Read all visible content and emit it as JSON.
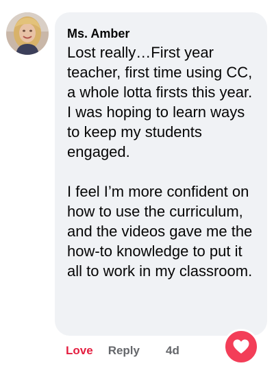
{
  "comment": {
    "author": "Ms. Amber",
    "paragraphs": [
      "Lost really…First year teacher, first time using CC, a whole lotta firsts this year. I was hoping to learn ways to keep my students engaged.",
      "I feel I’m more confident on how to use the curriculum, and the videos gave me the how-to knowledge to put it all to work in my classroom."
    ],
    "avatar_icon": "profile-photo",
    "bubble_color": "#f0f2f5"
  },
  "actions": {
    "love_label": "Love",
    "reply_label": "Reply",
    "timestamp": "4d",
    "love_color": "#e41e3f",
    "muted_color": "#65676b"
  },
  "reaction": {
    "icon": "heart-icon",
    "color": "#f33e58"
  }
}
